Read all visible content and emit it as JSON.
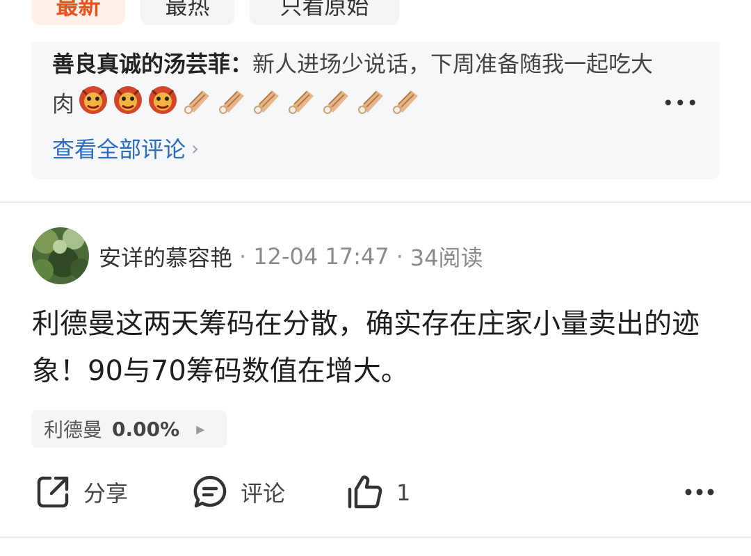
{
  "filter_tabs": [
    {
      "label": "最新",
      "active": true
    },
    {
      "label": "最热",
      "active": false
    },
    {
      "label": "只看原始",
      "active": false
    }
  ],
  "comment_preview": {
    "author": "善良真诚的汤芸菲：",
    "text": "新人进场少说话，下周准备随我一起吃大肉",
    "emojis": [
      "lion-dance-icon",
      "lion-dance-icon",
      "lion-dance-icon",
      "meat-icon",
      "meat-icon",
      "meat-icon",
      "meat-icon",
      "meat-icon",
      "meat-icon",
      "meat-icon"
    ],
    "view_all_label": "查看全部评论"
  },
  "post": {
    "author": "安详的慕容艳",
    "time": "12-04 17:47",
    "reads": "34阅读",
    "body": "利德曼这两天筹码在分散，确实存在庄家小量卖出的迹象！90与70筹码数值在增大。",
    "stock": {
      "name": "利德曼",
      "change": "0.00%"
    },
    "actions": {
      "share": "分享",
      "comment": "评论",
      "like_count": "1"
    }
  },
  "colors": {
    "accent": "#f0501e",
    "link": "#2b6cc4"
  }
}
